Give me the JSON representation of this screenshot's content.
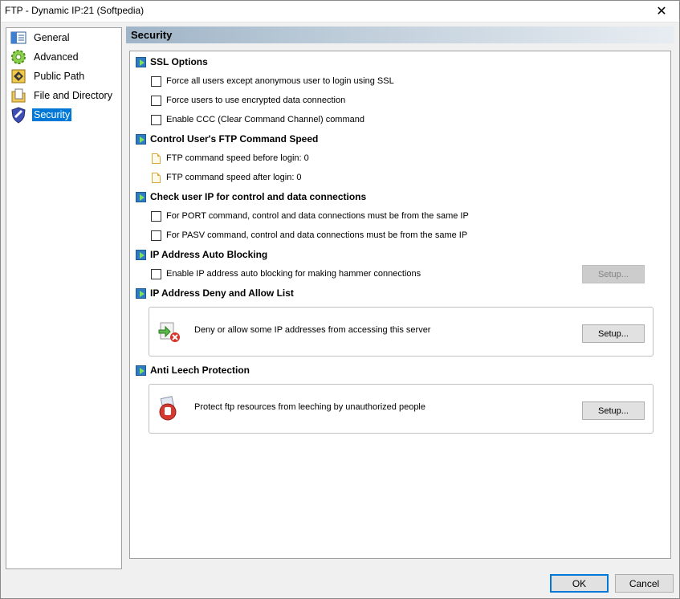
{
  "window": {
    "title": "FTP - Dynamic IP:21 (Softpedia)",
    "close_glyph": "✕"
  },
  "sidebar": {
    "items": [
      {
        "label": "General",
        "icon": "general-icon"
      },
      {
        "label": "Advanced",
        "icon": "gear-icon"
      },
      {
        "label": "Public Path",
        "icon": "public-path-icon"
      },
      {
        "label": "File and Directory",
        "icon": "file-directory-icon"
      },
      {
        "label": "Security",
        "icon": "shield-icon",
        "selected": true
      }
    ]
  },
  "header": {
    "title": "Security"
  },
  "sections": {
    "ssl": {
      "title": "SSL Options",
      "options": [
        "Force all users except anonymous user to login using SSL",
        "Force users to use encrypted data connection",
        "Enable CCC (Clear Command Channel) command"
      ]
    },
    "speed": {
      "title": "Control User's FTP Command Speed",
      "items": [
        "FTP command speed before login: 0",
        "FTP command speed after login: 0"
      ]
    },
    "check_ip": {
      "title": "Check user IP for control and data connections",
      "options": [
        "For PORT command, control and data connections must be from the same IP",
        "For PASV command, control and data connections must be from the same IP"
      ]
    },
    "auto_block": {
      "title": "IP Address Auto Blocking",
      "option": "Enable IP address auto blocking for making hammer connections",
      "setup_label": "Setup..."
    },
    "deny_allow": {
      "title": "IP Address Deny and Allow List",
      "text": "Deny or allow some IP addresses from accessing this server",
      "setup_label": "Setup..."
    },
    "anti_leech": {
      "title": "Anti Leech Protection",
      "text": "Protect ftp resources from leeching by unauthorized people",
      "setup_label": "Setup..."
    }
  },
  "footer": {
    "ok_label": "OK",
    "cancel_label": "Cancel"
  },
  "colors": {
    "accent": "#0078d7",
    "section_arrow": "#2e7bc4"
  }
}
